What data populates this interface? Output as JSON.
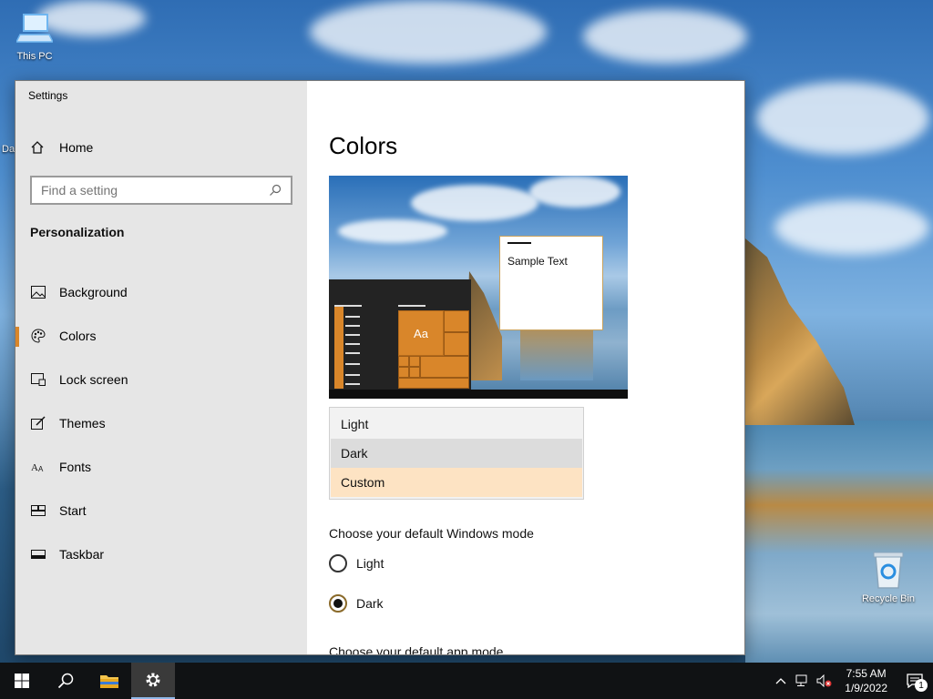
{
  "desktop": {
    "icons": [
      {
        "label": "This PC"
      },
      {
        "label": "Recycle Bin"
      }
    ],
    "partial_label": "Da"
  },
  "window": {
    "title": "Settings",
    "sidebar": {
      "home_label": "Home",
      "search_placeholder": "Find a setting",
      "section_heading": "Personalization",
      "items": [
        {
          "label": "Background",
          "icon": "picture-icon"
        },
        {
          "label": "Colors",
          "icon": "palette-icon",
          "active": true
        },
        {
          "label": "Lock screen",
          "icon": "lock-screen-icon"
        },
        {
          "label": "Themes",
          "icon": "brush-icon"
        },
        {
          "label": "Fonts",
          "icon": "font-icon"
        },
        {
          "label": "Start",
          "icon": "start-icon"
        },
        {
          "label": "Taskbar",
          "icon": "taskbar-icon"
        }
      ]
    },
    "main": {
      "title": "Colors",
      "preview": {
        "sample_text": "Sample Text",
        "tile_text": "Aa"
      },
      "color_mode_options": [
        "Light",
        "Dark",
        "Custom"
      ],
      "color_mode_selected": "Custom",
      "color_mode_hover": "Dark",
      "windows_mode_label": "Choose your default Windows mode",
      "windows_mode_options": [
        {
          "label": "Light",
          "checked": false
        },
        {
          "label": "Dark",
          "checked": true
        }
      ],
      "app_mode_label": "Choose your default app mode"
    }
  },
  "taskbar": {
    "time": "7:55 AM",
    "date": "1/9/2022",
    "notification_count": "1"
  },
  "colors": {
    "accent": "#d9862a",
    "selected_option_bg": "#fde3c3",
    "sidebar_bg": "#e6e6e6",
    "taskbar_bg": "#101214"
  }
}
